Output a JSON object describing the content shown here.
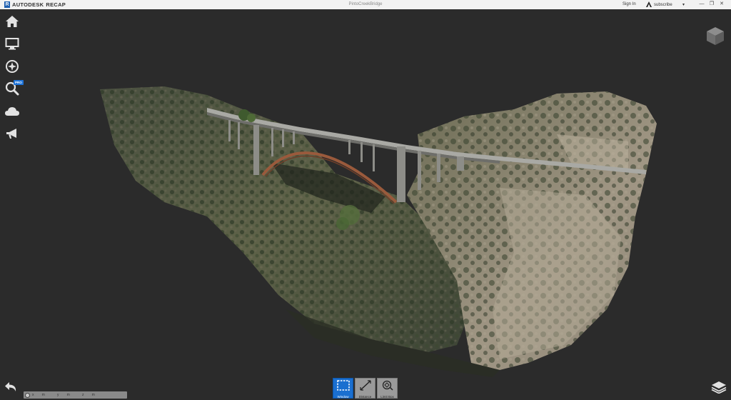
{
  "app": {
    "brand_prefix": "AUTODESK",
    "brand_product": "RECAP",
    "logo_letter": "R"
  },
  "window": {
    "doc_title": "PintoCreekBridge"
  },
  "account": {
    "sign_in": "Sign In",
    "subscribe": "subscribe",
    "dropdown_icon": "▾"
  },
  "window_controls": {
    "minimize": "—",
    "restore": "❐",
    "close": "✕"
  },
  "sidebar": {
    "items": [
      {
        "icon": "home-icon"
      },
      {
        "icon": "monitor-icon"
      },
      {
        "icon": "compass-icon"
      },
      {
        "icon": "search-icon",
        "badge": "PRO"
      },
      {
        "icon": "cloud-icon"
      },
      {
        "icon": "megaphone-icon"
      }
    ]
  },
  "coordinates": {
    "x_label": "x",
    "x_unit": "m",
    "y_label": "y",
    "y_unit": "m",
    "z_label": "z",
    "z_unit": "m"
  },
  "measure_tools": [
    {
      "label": "Window",
      "icon": "window-select-icon",
      "active": true
    },
    {
      "label": "Distance",
      "icon": "distance-icon",
      "active": false
    },
    {
      "label": "Limit Box",
      "icon": "limit-box-icon",
      "active": false
    }
  ],
  "colors": {
    "background": "#2b2b2b",
    "accent": "#1a6fd0",
    "titlebar": "#f2f2f2"
  }
}
